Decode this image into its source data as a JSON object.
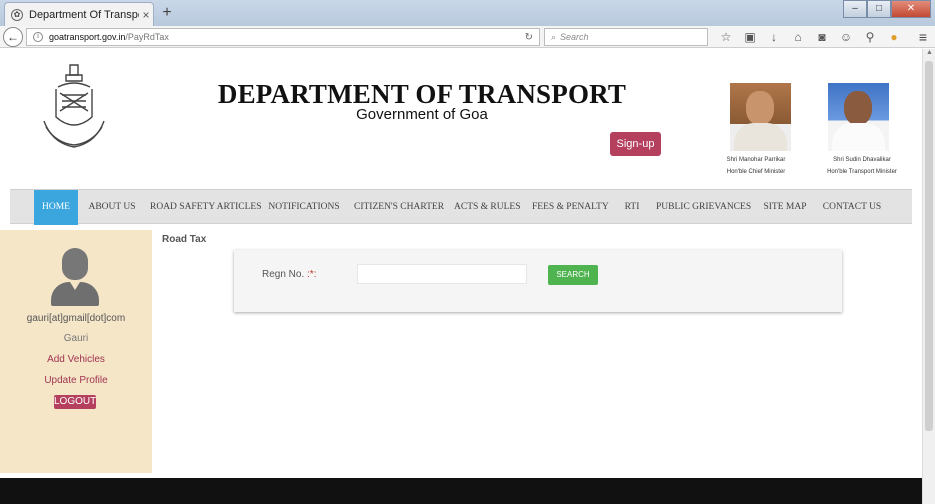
{
  "browser": {
    "tab_title": "Department Of Transport,...",
    "new_tab": "+",
    "tab_close": "×",
    "url_host": "goatransport.gov.in",
    "url_path": "/PayRdTax",
    "search_placeholder": "Search",
    "icons": [
      "star-icon",
      "clipboard-icon",
      "download-icon",
      "home-icon",
      "pocket-icon",
      "chat-icon",
      "tool-icon",
      "color-icon"
    ]
  },
  "header": {
    "title": "DEPARTMENT OF TRANSPORT",
    "subtitle": "Government of Goa",
    "signup_label": "Sign-up",
    "officials": [
      {
        "name": "Shri Manohar Parrikar",
        "role": "Hon'ble Chief Minister"
      },
      {
        "name": "Shri Sudin Dhavalikar",
        "role": "Hon'ble Transport Minister"
      }
    ]
  },
  "menu": {
    "items": [
      "HOME",
      "ABOUT US",
      "ROAD SAFETY ARTICLES",
      "NOTIFICATIONS",
      "CITIZEN'S CHARTER",
      "ACTS & RULES",
      "FEES & PENALTY",
      "RTI",
      "PUBLIC GRIEVANCES",
      "SITE MAP",
      "CONTACT US"
    ],
    "active": "HOME",
    "active_color": "#3aa6dd"
  },
  "sidebar": {
    "email": "gauri[at]gmail[dot]com",
    "name": "Gauri",
    "add_vehicles": "Add Vehicles",
    "update_profile": "Update Profile",
    "logout": "LOGOUT"
  },
  "content": {
    "heading": "Road Tax",
    "regn_label": "Regn No.",
    "required_mark": ":*:",
    "regn_value": "",
    "search_label": "SEARCH"
  },
  "colors": {
    "accent": "#b5405e",
    "search_button": "#4fb34f",
    "sidebar_bg": "#f5e6c8"
  }
}
